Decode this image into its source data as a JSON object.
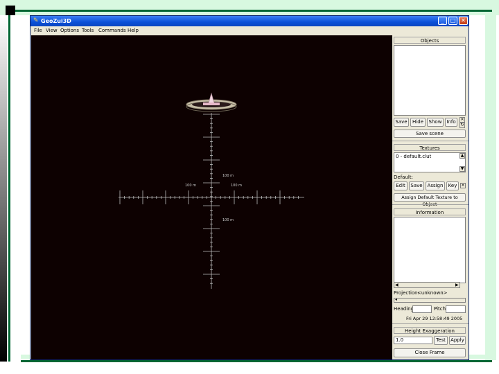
{
  "window": {
    "title": "GeoZui3D",
    "icon": "geozui-app-icon",
    "controls": {
      "minimize": "minimize-icon",
      "maximize": "maximize-icon",
      "close": "close-icon"
    }
  },
  "menubar": [
    "File",
    "View",
    "Options",
    "Tools",
    "Commands",
    "Help"
  ],
  "viewport": {
    "background": "#0d0101",
    "scale_labels": {
      "top": "100 m",
      "left": "100 m",
      "right": "100 m",
      "bottom": "100 m"
    }
  },
  "objects": {
    "title": "Objects",
    "buttons": [
      "Save",
      "Hide",
      "Show",
      "Info"
    ],
    "save_scene": "Save scene"
  },
  "textures": {
    "title": "Textures",
    "items": [
      "0 - default.clut"
    ],
    "default_label": "Default:",
    "buttons": [
      "Edit",
      "Save",
      "Assign",
      "Key"
    ],
    "assign_default": "Assign Default Texture to Object"
  },
  "information": {
    "title": "Information",
    "projection_label": "Projection:",
    "projection_value": "<unknown>",
    "heading_label": "Heading",
    "pitch_label": "Pitch",
    "datetime": "Fri Apr 29 12:58:49 2005"
  },
  "height_exaggeration": {
    "title": "Height Exaggeration",
    "value": "1.0",
    "test": "Test",
    "apply": "Apply"
  },
  "close_frame": "Close Frame"
}
